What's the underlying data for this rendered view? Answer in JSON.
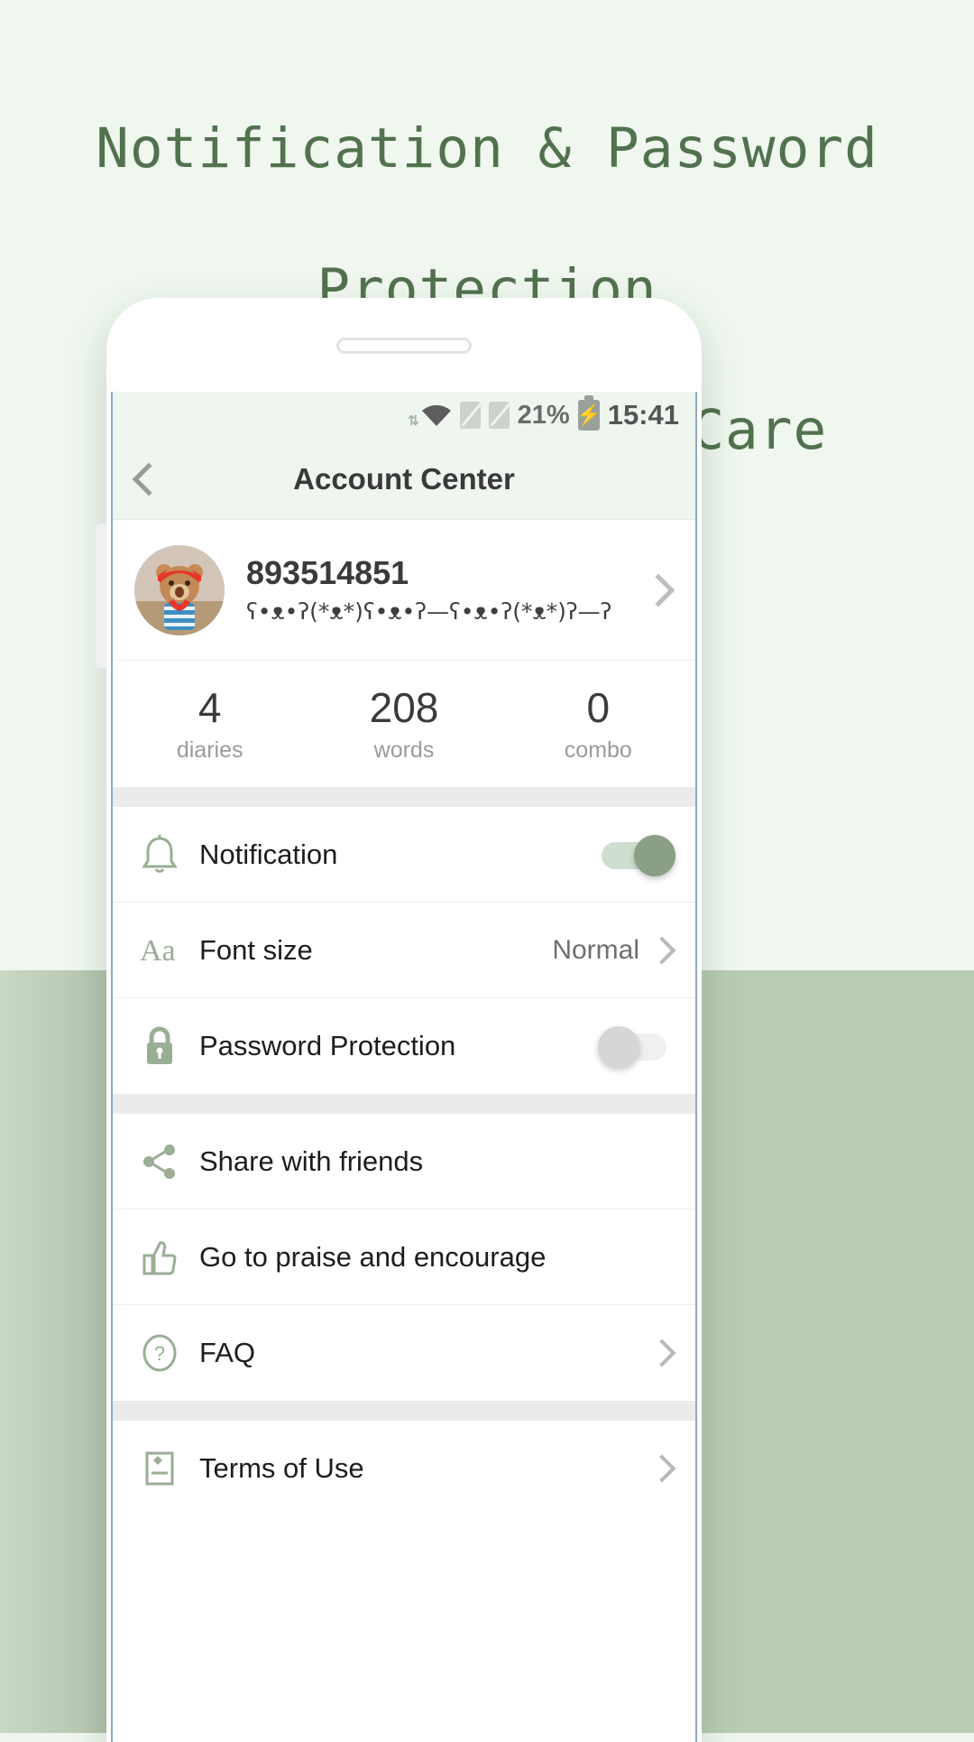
{
  "headline": {
    "line1": "Notification & Password",
    "line2": "Protection",
    "line3": "Thoughtful with Care",
    "color": "#52714e"
  },
  "status_bar": {
    "wifi_icon": "wifi-icon",
    "sim1_icon": "sim-card-off-icon",
    "sim2_icon": "sim-card-off-icon",
    "battery_percent": "21%",
    "battery_icon": "battery-charging-icon",
    "clock": "15:41"
  },
  "app_bar": {
    "back_icon": "chevron-left-icon",
    "title": "Account Center"
  },
  "profile": {
    "avatar_icon": "teddy-bear-avatar",
    "username": "893514851",
    "kaomoji": "ʕ•ᴥ•ʔ(*ᴥ*)ʕ•ᴥ•ʔ—ʕ•ᴥ•ʔ(*ᴥ*)ʔ—ʔ",
    "chevron_icon": "chevron-right-icon"
  },
  "stats": [
    {
      "value": "4",
      "label": "diaries"
    },
    {
      "value": "208",
      "label": "words"
    },
    {
      "value": "0",
      "label": "combo"
    }
  ],
  "settings_group": [
    {
      "icon": "bell-icon",
      "label": "Notification",
      "control": "toggle",
      "toggle_on": true
    },
    {
      "icon": "font-size-icon",
      "label": "Font size",
      "control": "value-chevron",
      "value": "Normal"
    },
    {
      "icon": "lock-icon",
      "label": "Password Protection",
      "control": "toggle",
      "toggle_on": false
    }
  ],
  "actions_group": [
    {
      "icon": "share-icon",
      "label": "Share with friends",
      "control": "none"
    },
    {
      "icon": "thumbs-up-icon",
      "label": "Go to praise and encourage",
      "control": "none"
    },
    {
      "icon": "question-circle-icon",
      "label": "FAQ",
      "control": "chevron"
    }
  ],
  "legal_group": [
    {
      "icon": "document-icon",
      "label": "Terms of Use",
      "control": "chevron"
    }
  ],
  "colors": {
    "accent": "#8a9f85",
    "headline": "#52714e",
    "bg_top": "#eff7ef",
    "bg_bottom": "#b9cbb4",
    "icon_green": "#9aae95"
  }
}
